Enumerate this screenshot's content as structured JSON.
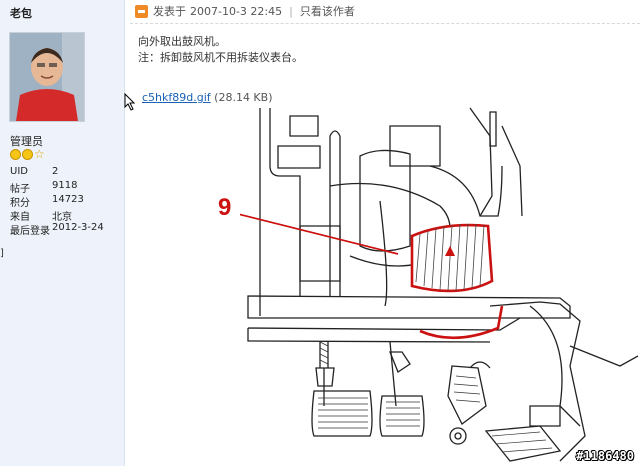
{
  "user": {
    "name": "老包",
    "role": "管理员",
    "stats": [
      {
        "label": "UID",
        "value": "2"
      },
      {
        "label": "帖子",
        "value": "9118"
      },
      {
        "label": "积分",
        "value": "14723"
      },
      {
        "label": "来自",
        "value": "北京"
      },
      {
        "label": "最后登录",
        "value": "2012-3-24"
      }
    ],
    "edge_char": "]"
  },
  "post": {
    "posted_label": "发表于",
    "posted_time": "2007-10-3 22:45",
    "only_author": "只看该作者",
    "lines": [
      "向外取出鼓风机。",
      "注：拆卸鼓风机不用拆装仪表台。"
    ],
    "attachment_name": "c5hkf89d.gif",
    "attachment_size": "(28.14 KB)"
  },
  "drawing": {
    "callout_number": "9",
    "callout_color": "#cc1111"
  },
  "watermark": "#1186480"
}
